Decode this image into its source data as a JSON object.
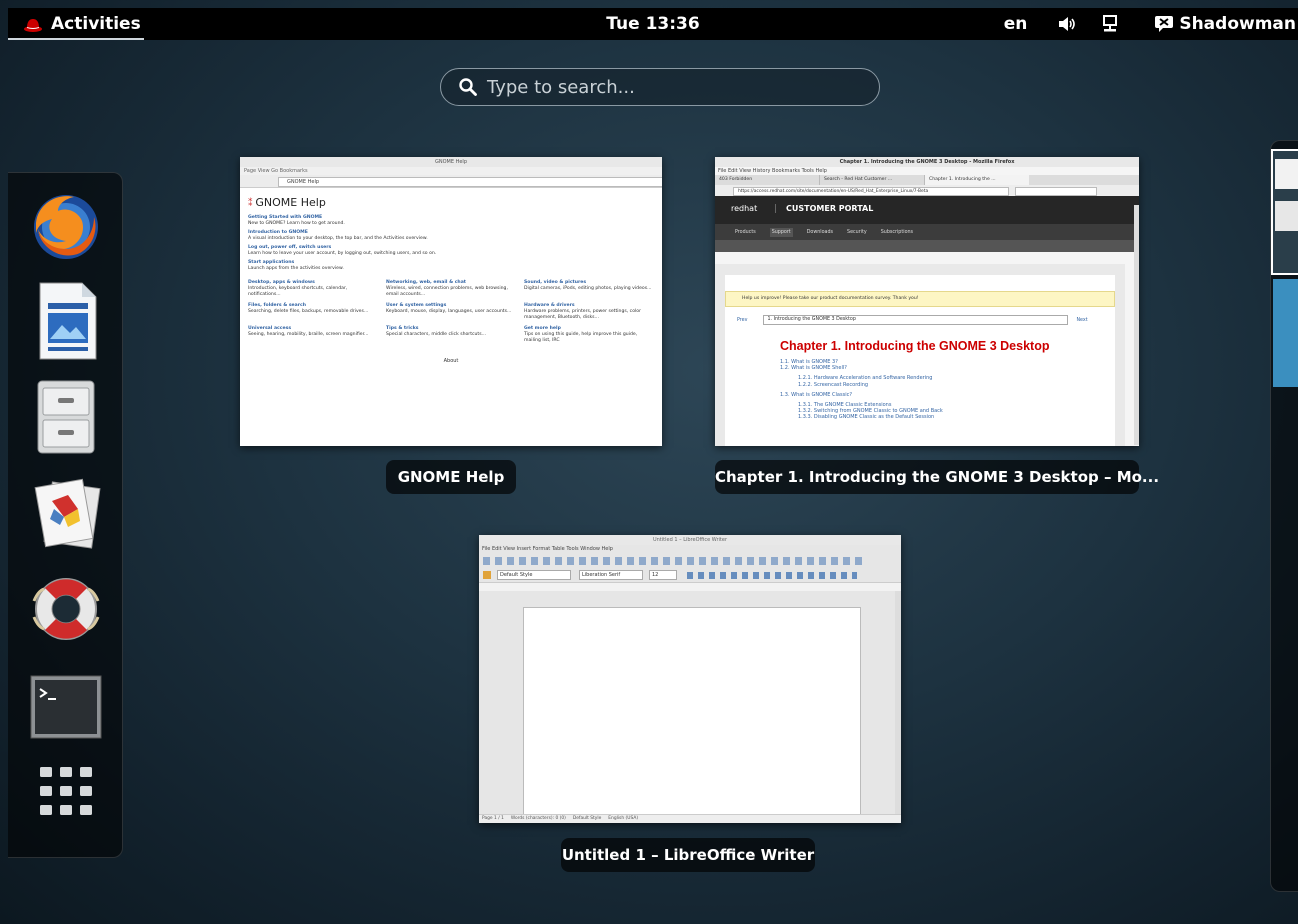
{
  "topbar": {
    "activities_label": "Activities",
    "clock": "Tue 13:36",
    "keyboard_layout": "en",
    "user_name": "Shadowman"
  },
  "search": {
    "placeholder": "Type to search..."
  },
  "dash": {
    "apps": [
      {
        "name": "firefox-icon"
      },
      {
        "name": "libreoffice-writer-icon"
      },
      {
        "name": "files-icon"
      },
      {
        "name": "documents-icon"
      },
      {
        "name": "help-icon"
      },
      {
        "name": "terminal-icon"
      },
      {
        "name": "show-applications-icon"
      }
    ]
  },
  "windows": [
    {
      "title": "GNOME Help"
    },
    {
      "title": "Chapter 1. Introducing the GNOME 3 Desktop – Mo..."
    },
    {
      "title": "Untitled 1 – LibreOffice Writer"
    }
  ],
  "help_window": {
    "titlebar": "GNOME Help",
    "menu": "Page  View  Go  Bookmarks",
    "location": "GNOME Help",
    "heading": "GNOME Help",
    "links": [
      {
        "title": "Getting Started with GNOME",
        "desc": "New to GNOME? Learn how to get around."
      },
      {
        "title": "Introduction to GNOME",
        "desc": "A visual introduction to your desktop, the top bar, and the Activities overview."
      },
      {
        "title": "Log out, power off, switch users",
        "desc": "Learn how to leave your user account, by logging out, switching users, and so on."
      },
      {
        "title": "Start applications",
        "desc": "Launch apps from the activities overview."
      }
    ],
    "grid": [
      {
        "title": "Desktop, apps & windows",
        "desc": "Introduction, keyboard shortcuts, calendar, notifications..."
      },
      {
        "title": "Networking, web, email & chat",
        "desc": "Wireless, wired, connection problems, web browsing, email accounts..."
      },
      {
        "title": "Sound, video & pictures",
        "desc": "Digital cameras, iPods, editing photos, playing videos..."
      },
      {
        "title": "Files, folders & search",
        "desc": "Searching, delete files, backups, removable drives..."
      },
      {
        "title": "User & system settings",
        "desc": "Keyboard, mouse, display, languages, user accounts..."
      },
      {
        "title": "Hardware & drivers",
        "desc": "Hardware problems, printers, power settings, color management, Bluetooth, disks..."
      },
      {
        "title": "Universal access",
        "desc": "Seeing, hearing, mobility, braille, screen magnifier..."
      },
      {
        "title": "Tips & tricks",
        "desc": "Special characters, middle click shortcuts..."
      },
      {
        "title": "Get more help",
        "desc": "Tips on using this guide, help improve this guide, mailing list, IRC"
      }
    ],
    "about": "About"
  },
  "firefox_window": {
    "titlebar": "Chapter 1. Introducing the GNOME 3 Desktop - Mozilla Firefox",
    "menu": "File  Edit  View  History  Bookmarks  Tools  Help",
    "tabs": [
      "403 Forbidden",
      "Search - Red Hat Customer ...",
      "Chapter 1. Introducing the ..."
    ],
    "url": "https://access.redhat.com/site/documentation/en-US/Red_Hat_Enterprise_Linux/7-Beta",
    "portal_brand": "redhat",
    "portal_title": "CUSTOMER PORTAL",
    "nav": [
      "Products",
      "Support",
      "Downloads",
      "Security",
      "Subscriptions"
    ],
    "notice": "Help us improve! Please take our product documentation survey. Thank you!",
    "prev": "Prev",
    "next": "Next",
    "select": "1. Introducing the GNOME 3 Desktop",
    "chapter_heading": "Chapter 1. Introducing the GNOME 3 Desktop",
    "toc": [
      "1.1. What is GNOME 3?",
      "1.2. What is GNOME Shell?",
      "1.2.1. Hardware Acceleration and Software Rendering",
      "1.2.2. Screencast Recording",
      "1.3. What is GNOME Classic?",
      "1.3.1. The GNOME Classic Extensions",
      "1.3.2. Switching from GNOME Classic to GNOME and Back",
      "1.3.3. Disabling GNOME Classic as the Default Session"
    ]
  },
  "writer_window": {
    "titlebar": "Untitled 1 – LibreOffice Writer",
    "menu": "File  Edit  View  Insert  Format  Table  Tools  Window  Help",
    "style": "Default Style",
    "font": "Liberation Serif",
    "size": "12",
    "status": "Page 1 / 1     Words (characters): 0 (0)     Default Style     English (USA)"
  }
}
